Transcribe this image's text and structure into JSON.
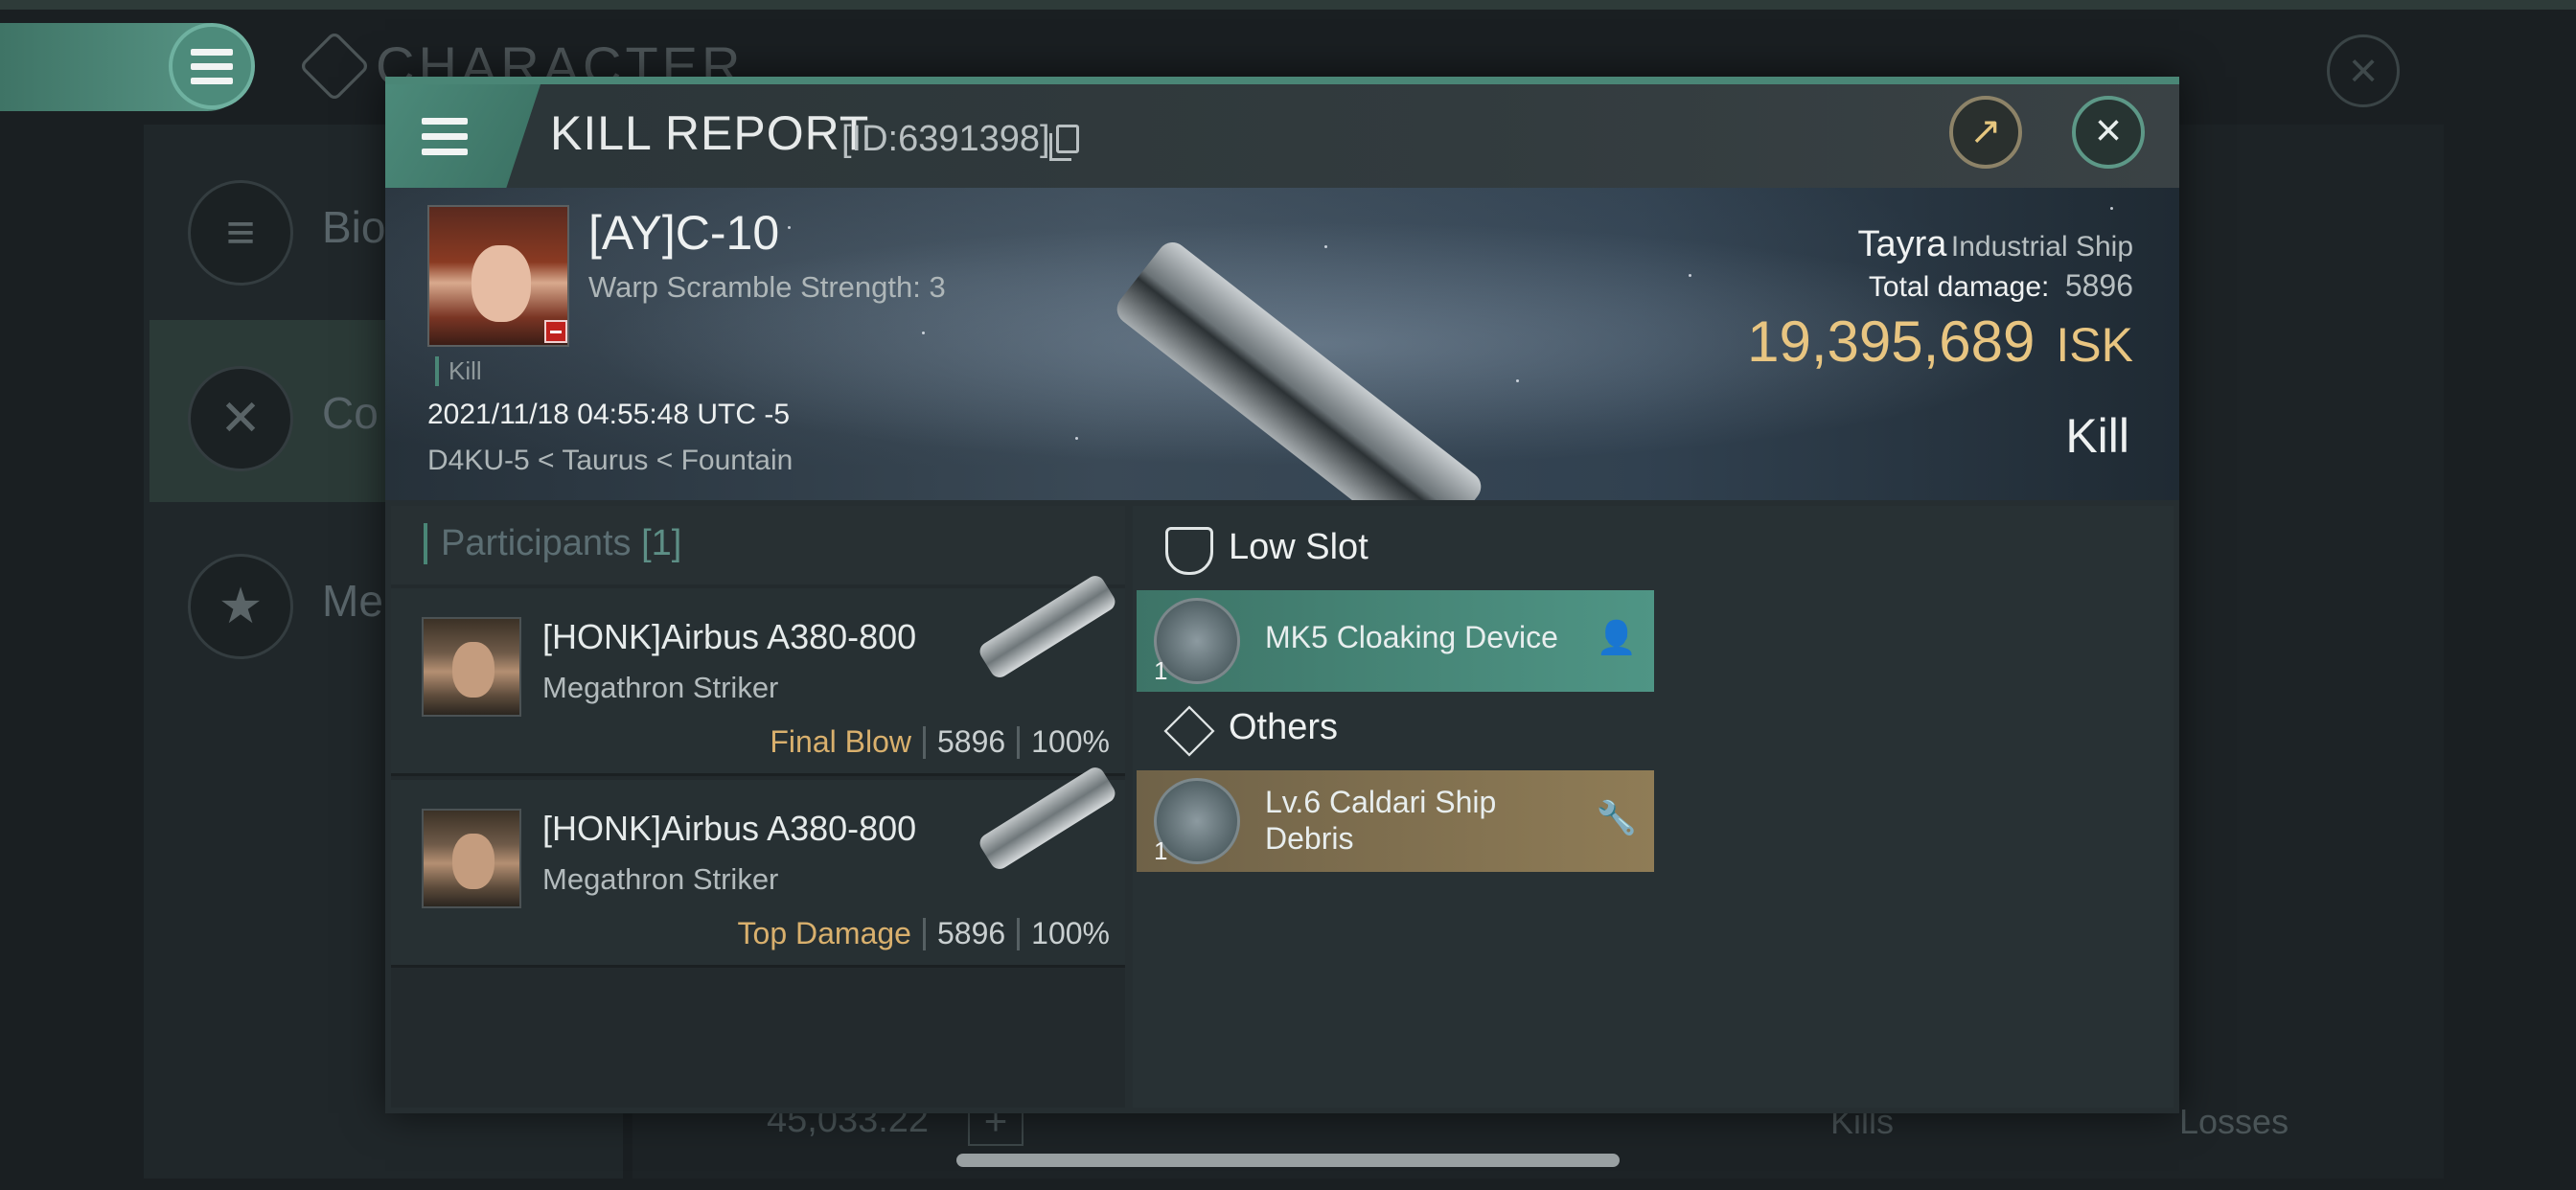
{
  "background": {
    "title": "CHARACTER",
    "nav_items": [
      {
        "label": "Bio"
      },
      {
        "label": "Co"
      },
      {
        "label": "Me"
      }
    ],
    "isk_balance": "45,033.22",
    "kills_label": "Kills",
    "losses_label": "Losses"
  },
  "dialog": {
    "title": "KILL REPORT",
    "id_text": "[ID:6391398]"
  },
  "victim": {
    "name": "[AY]C-10",
    "subtitle": "Warp Scramble Strength: 3",
    "tag": "Kill",
    "timestamp": "2021/11/18 04:55:48 UTC -5",
    "location": "D4KU-5 < Taurus < Fountain",
    "ship_name": "Tayra",
    "ship_class": "Industrial Ship",
    "total_damage_label": "Total damage:",
    "total_damage": "5896",
    "isk_value": "19,395,689",
    "isk_unit": "ISK",
    "result": "Kill"
  },
  "participants": {
    "label": "Participants",
    "count": "[1]",
    "rows": [
      {
        "name": "[HONK]Airbus A380-800",
        "ship": "Megathron Striker",
        "role": "Final Blow",
        "damage": "5896",
        "percent": "100%"
      },
      {
        "name": "[HONK]Airbus A380-800",
        "ship": "Megathron Striker",
        "role": "Top Damage",
        "damage": "5896",
        "percent": "100%"
      }
    ]
  },
  "slots": {
    "low_slot_label": "Low Slot",
    "low_slot_item": {
      "name": "MK5 Cloaking Device",
      "qty": "1",
      "icon": "person-icon"
    },
    "others_label": "Others",
    "others_item": {
      "name": "Lv.6 Caldari Ship Debris",
      "qty": "1",
      "icon": "wrench-icon"
    }
  },
  "colors": {
    "accent": "#4a8676",
    "isk_gold": "#e8c581",
    "role_gold": "#d9b06d"
  }
}
